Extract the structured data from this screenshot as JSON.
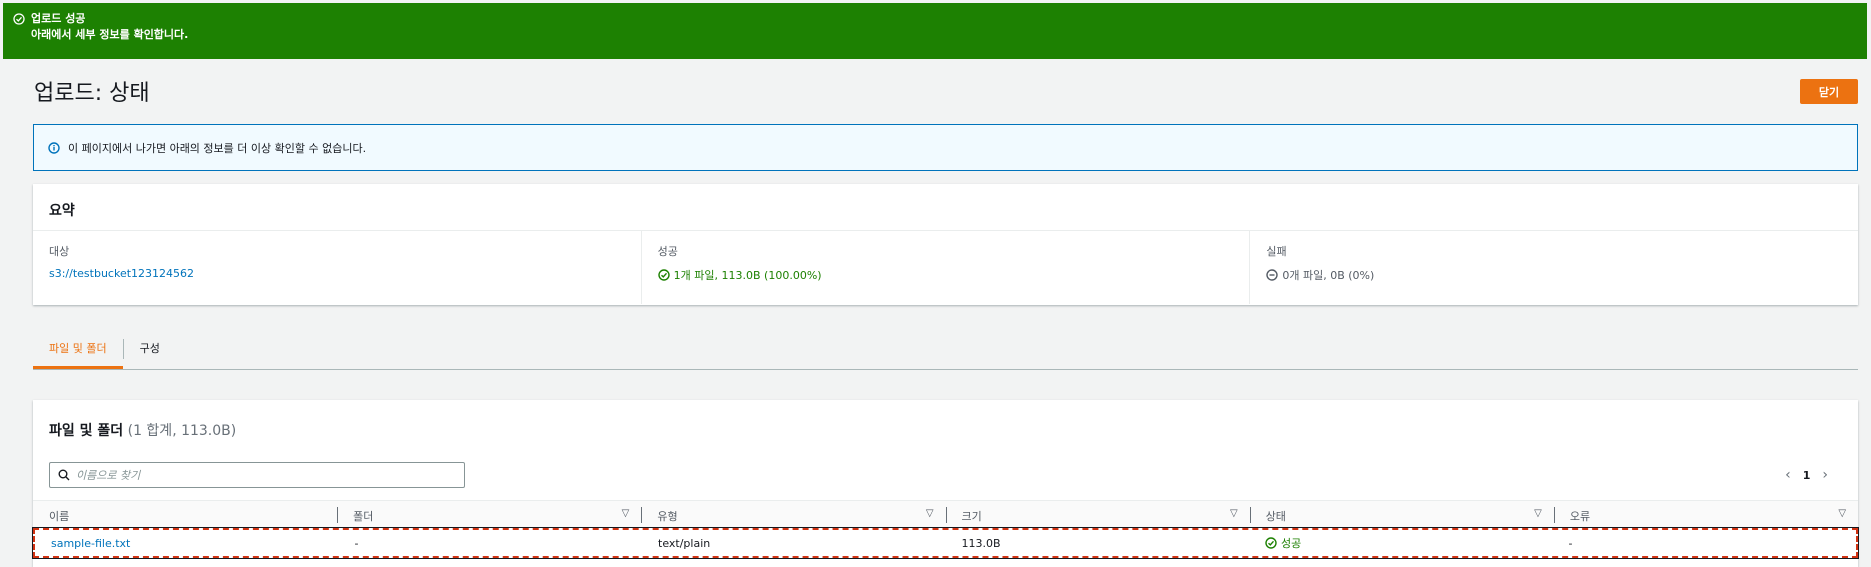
{
  "flash": {
    "title": "업로드 성공",
    "description": "아래에서 세부 정보를 확인합니다."
  },
  "page": {
    "title": "업로드: 상태",
    "close_label": "닫기"
  },
  "info_alert": {
    "text": "이 페이지에서 나가면 아래의 정보를 더 이상 확인할 수 없습니다."
  },
  "summary": {
    "header": "요약",
    "destination_label": "대상",
    "destination_value": "s3://testbucket123124562",
    "success_label": "성공",
    "success_value": "1개 파일, 113.0B (100.00%)",
    "failed_label": "실패",
    "failed_value": "0개 파일, 0B (0%)"
  },
  "tabs": [
    {
      "label": "파일 및 폴더",
      "active": true
    },
    {
      "label": "구성",
      "active": false
    }
  ],
  "files": {
    "title": "파일 및 폴더",
    "count": "(1 합계, 113.0B)",
    "search_placeholder": "이름으로 찾기",
    "page_number": "1",
    "columns": [
      "이름",
      "폴더",
      "유형",
      "크기",
      "상태",
      "오류"
    ],
    "rows": [
      {
        "name": "sample-file.txt",
        "folder": "-",
        "type": "text/plain",
        "size": "113.0B",
        "status": "성공",
        "error": "-"
      }
    ]
  },
  "colors": {
    "success": "#1d8102",
    "primary": "#ec7211",
    "link": "#0073bb"
  }
}
